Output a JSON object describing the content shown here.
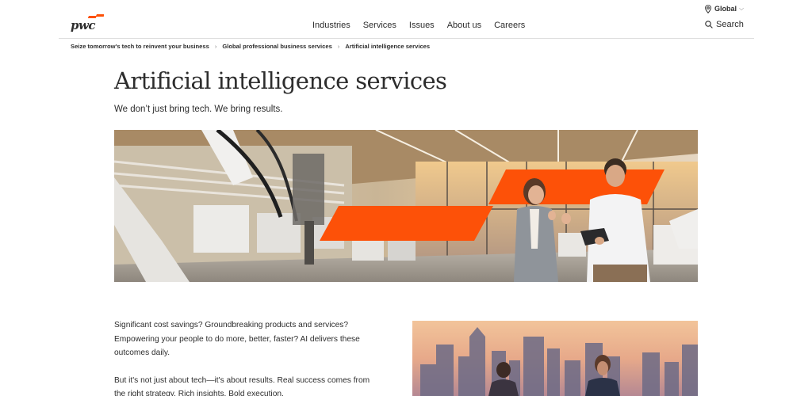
{
  "header": {
    "logo_text": "pwc",
    "region_label": "Global",
    "search_label": "Search",
    "nav_items": [
      {
        "label": "Industries"
      },
      {
        "label": "Services"
      },
      {
        "label": "Issues"
      },
      {
        "label": "About us"
      },
      {
        "label": "Careers"
      }
    ]
  },
  "breadcrumb": [
    {
      "label": "Seize tomorrow's tech to reinvent your business"
    },
    {
      "label": "Global professional business services"
    },
    {
      "label": "Artificial intelligence services"
    }
  ],
  "page": {
    "title": "Artificial intelligence services",
    "subtitle": "We don’t just bring tech. We bring results."
  },
  "body": {
    "paragraphs": [
      "Significant cost savings? Groundbreaking products and services? Empowering your people to do more, better, faster? AI delivers these outcomes daily.",
      "But it's not just about tech—it's about results. Real success comes from the right strategy. Rich insights. Bold execution."
    ]
  },
  "colors": {
    "accent": "#fd5108",
    "text": "#2d2d2d",
    "rule": "#dedede"
  },
  "icons": {
    "region": "location-pin-icon",
    "region_dropdown": "chevron-down-icon",
    "search": "search-icon",
    "breadcrumb_separator": "chevron-right-icon"
  }
}
